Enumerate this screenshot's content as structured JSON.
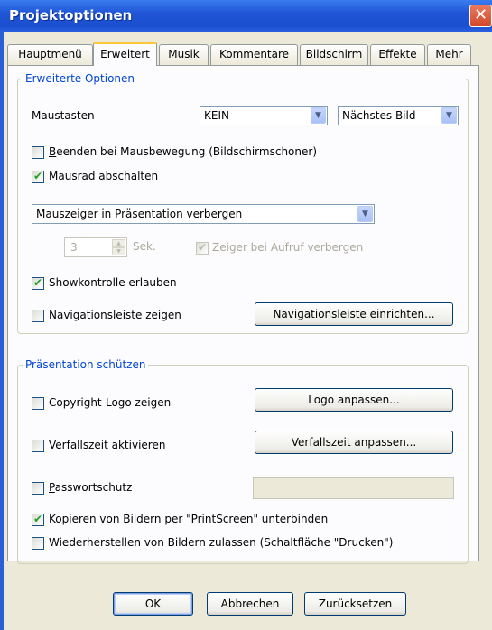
{
  "window": {
    "title": "Projektoptionen",
    "close_glyph": "✕"
  },
  "tabs": [
    {
      "label": "Hauptmenü",
      "active": false
    },
    {
      "label": "Erweitert",
      "active": true
    },
    {
      "label": "Musik",
      "active": false
    },
    {
      "label": "Kommentare",
      "active": false
    },
    {
      "label": "Bildschirm",
      "active": false
    },
    {
      "label": "Effekte",
      "active": false
    },
    {
      "label": "Mehr",
      "active": false
    }
  ],
  "advanced": {
    "legend": "Erweiterte Optionen",
    "mouse_buttons_label": "Maustasten",
    "mouse_left_value": "KEIN",
    "mouse_right_value": "Nächstes Bild",
    "quit_on_mouse_move": {
      "label_prefix": "",
      "label_underlined": "B",
      "label_rest": "eenden bei Mausbewegung (Bildschirmschoner)",
      "checked": false
    },
    "disable_mouse_wheel": {
      "label": "Mausrad abschalten",
      "checked": true
    },
    "cursor_mode_value": "Mauszeiger in Präsentation verbergen",
    "seconds_value": "3",
    "seconds_unit": "Sek.",
    "hide_on_call": {
      "label": "Zeiger bei Aufruf verbergen",
      "checked": true
    },
    "allow_show_control": {
      "label": "Showkontrolle erlauben",
      "checked": true
    },
    "show_nav_bar": {
      "label_prefix": "Navigationsleiste ",
      "label_underlined": "z",
      "label_rest": "eigen",
      "checked": false
    },
    "setup_nav_bar_button": "Navigationsleiste einrichten..."
  },
  "protect": {
    "legend": "Präsentation schützen",
    "copyright_logo": {
      "label": "Copyright-Logo zeigen",
      "checked": false
    },
    "adjust_logo_button": "Logo anpassen...",
    "expiry": {
      "label": "Verfallszeit aktivieren",
      "checked": false
    },
    "adjust_expiry_button": "Verfallszeit anpassen...",
    "password": {
      "label_prefix": "",
      "label_underlined": "P",
      "label_rest": "asswortschutz",
      "checked": false
    },
    "password_value": "",
    "block_printscreen": {
      "label": "Kopieren von Bildern per \"PrintScreen\" unterbinden",
      "checked": true
    },
    "allow_restore": {
      "label": "Wiederherstellen von Bildern zulassen (Schaltfläche \"Drucken\")",
      "checked": false
    }
  },
  "footer": {
    "ok": "OK",
    "cancel": "Abbrechen",
    "reset": "Zurücksetzen"
  },
  "colors": {
    "title_bar": "#1f55d6",
    "dialog_face": "#ece9d8",
    "group_legend": "#0046d5",
    "check_mark": "#21a121"
  }
}
